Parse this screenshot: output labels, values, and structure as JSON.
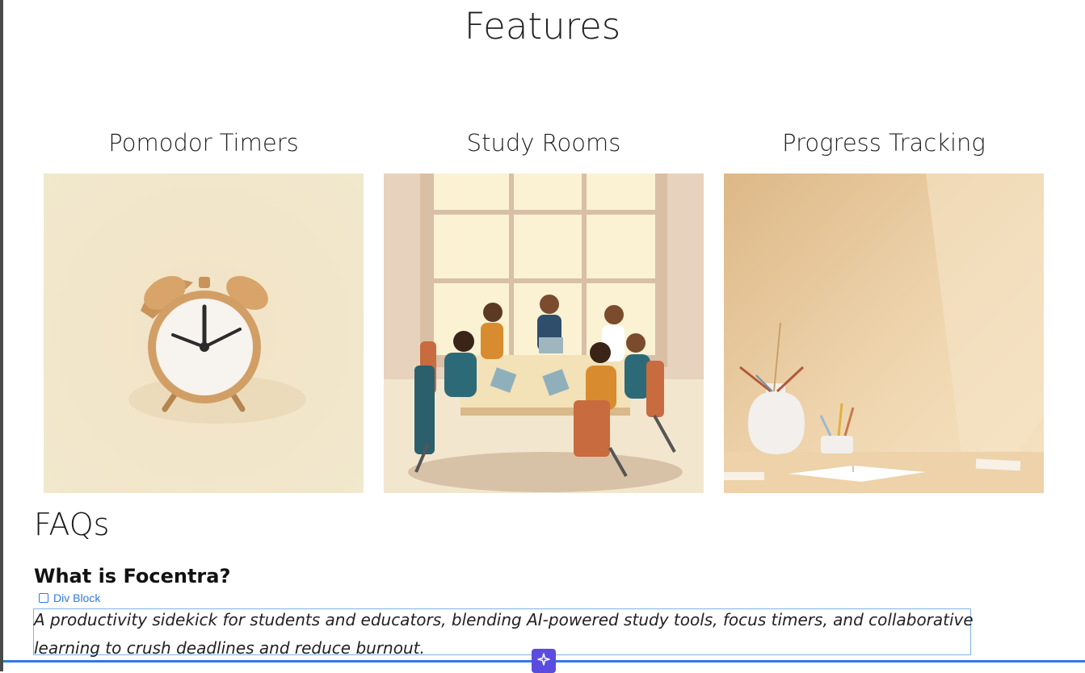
{
  "features": {
    "title": "Features",
    "items": [
      {
        "title": "Pomodor Timers",
        "image": "alarm-clock-illustration"
      },
      {
        "title": "Study Rooms",
        "image": "group-study-illustration"
      },
      {
        "title": "Progress Tracking",
        "image": "desk-vase-books-illustration"
      }
    ]
  },
  "faqs": {
    "title": "FAQs",
    "question": "What is Focentra?",
    "answer": "A productivity sidekick for students and educators, blending AI-powered study tools, focus timers, and collaborative learning to crush deadlines and reduce burnout."
  },
  "editor": {
    "selection_label": "Div Block",
    "selection_icon": "square-icon",
    "ai_button_icon": "sparkle-icon",
    "accent_color": "#2f7ae5",
    "ai_button_color": "#5b4ce0"
  }
}
